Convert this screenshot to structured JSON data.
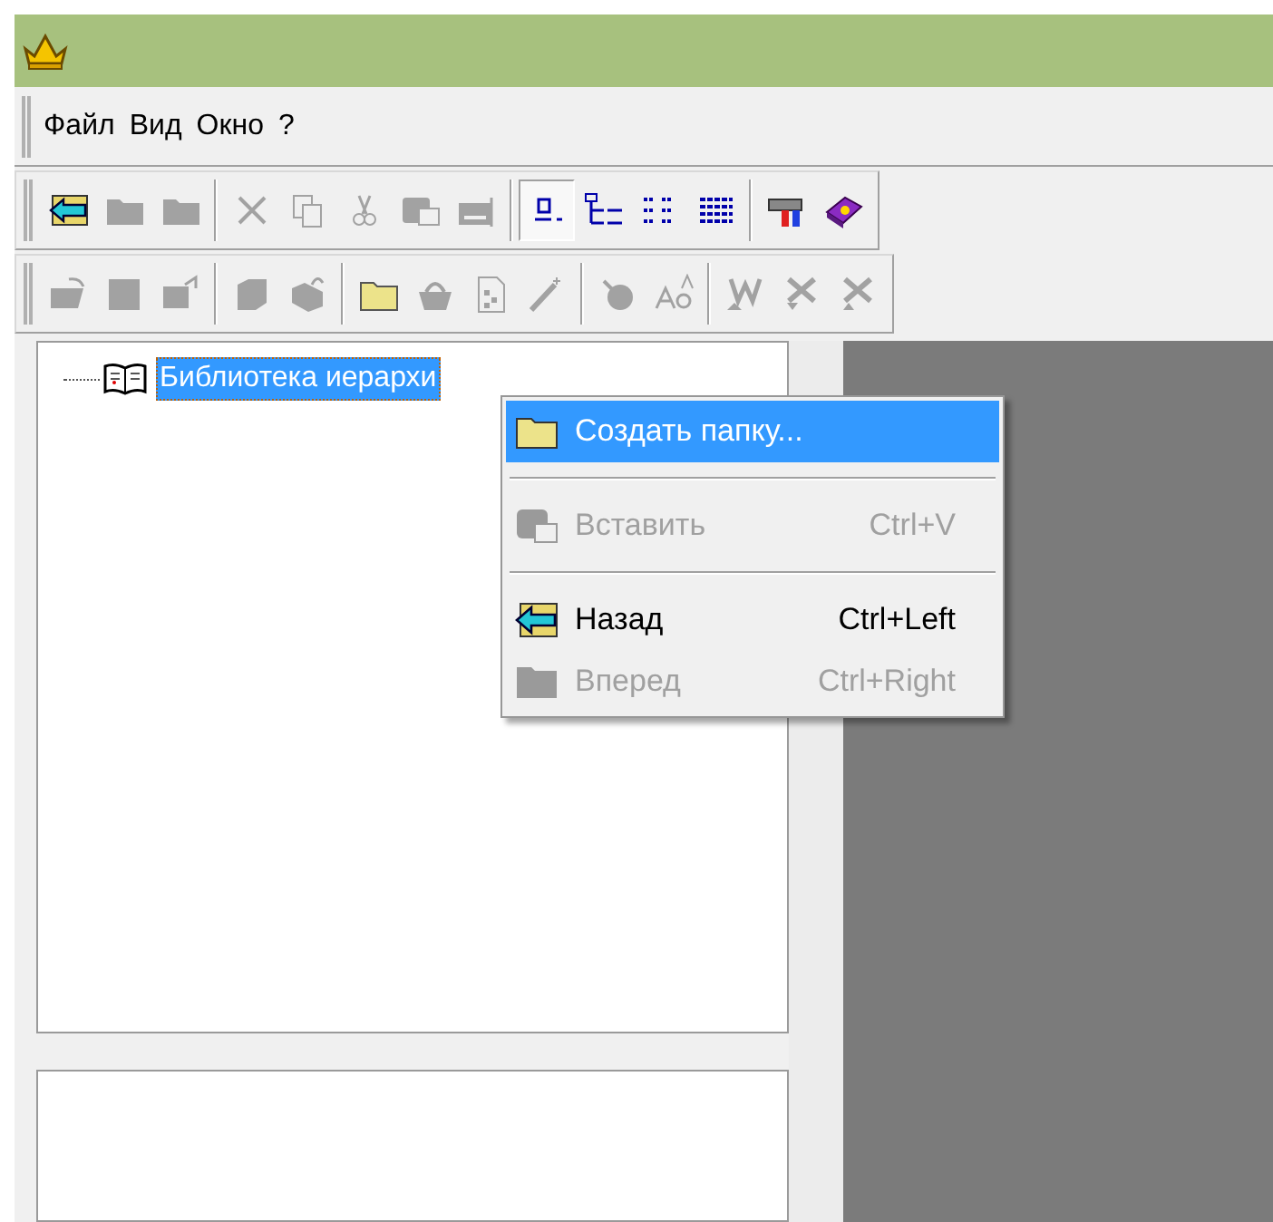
{
  "menu_bar": {
    "items": [
      {
        "label": "Файл"
      },
      {
        "label": "Вид"
      },
      {
        "label": "Окно"
      },
      {
        "label": "?"
      }
    ]
  },
  "toolbars": [
    {
      "groups": [
        [
          {
            "disabled": false,
            "selected": false
          },
          {
            "disabled": true,
            "selected": false
          },
          {
            "disabled": true,
            "selected": false
          }
        ],
        [
          {
            "disabled": true,
            "selected": false
          },
          {
            "disabled": true,
            "selected": false
          },
          {
            "disabled": true,
            "selected": false
          },
          {
            "disabled": true,
            "selected": false
          },
          {
            "disabled": true,
            "selected": false
          }
        ],
        [
          {
            "disabled": false,
            "selected": true
          },
          {
            "disabled": false,
            "selected": false
          },
          {
            "disabled": false,
            "selected": false
          },
          {
            "disabled": false,
            "selected": false
          }
        ],
        [
          {
            "disabled": false,
            "selected": false
          },
          {
            "disabled": false,
            "selected": false
          }
        ]
      ]
    },
    {
      "groups": [
        [
          {
            "disabled": true,
            "selected": false
          },
          {
            "disabled": true,
            "selected": false
          },
          {
            "disabled": true,
            "selected": false
          }
        ],
        [
          {
            "disabled": true,
            "selected": false
          },
          {
            "disabled": true,
            "selected": false
          }
        ],
        [
          {
            "disabled": false,
            "selected": false
          },
          {
            "disabled": true,
            "selected": false
          },
          {
            "disabled": true,
            "selected": false
          },
          {
            "disabled": true,
            "selected": false
          }
        ],
        [
          {
            "disabled": true,
            "selected": false
          },
          {
            "disabled": true,
            "selected": false
          }
        ],
        [
          {
            "disabled": true,
            "selected": false
          },
          {
            "disabled": true,
            "selected": false
          },
          {
            "disabled": true,
            "selected": false
          }
        ]
      ]
    }
  ],
  "tree": {
    "items": [
      {
        "label": "Библиотека иерархи",
        "selected": true
      }
    ]
  },
  "context_menu": {
    "items": [
      {
        "kind": "item",
        "label": "Создать папку...",
        "selected": true,
        "disabled": false
      },
      {
        "kind": "separator"
      },
      {
        "kind": "item",
        "label": "Вставить",
        "shortcut": "Ctrl+V",
        "selected": false,
        "disabled": true
      },
      {
        "kind": "separator"
      },
      {
        "kind": "item",
        "label": "Назад",
        "shortcut": "Ctrl+Left",
        "selected": false,
        "disabled": false
      },
      {
        "kind": "item",
        "label": "Вперед",
        "shortcut": "Ctrl+Right",
        "selected": false,
        "disabled": true
      }
    ]
  }
}
